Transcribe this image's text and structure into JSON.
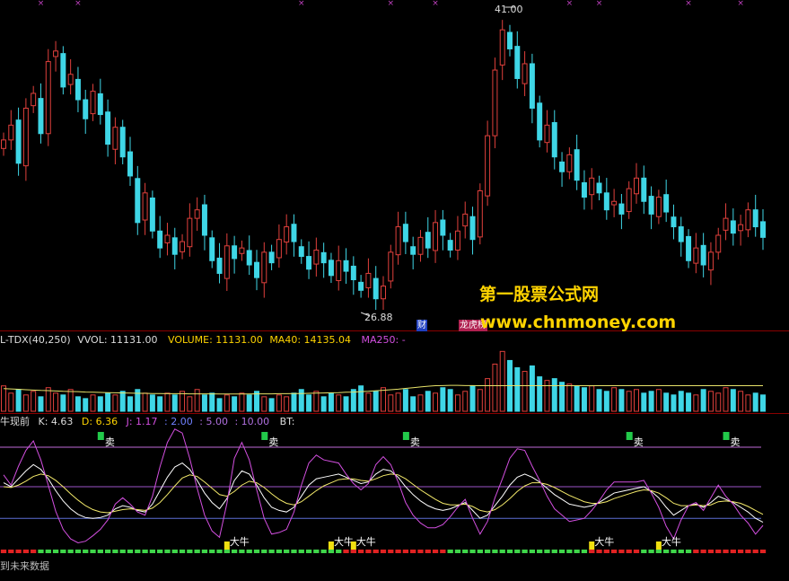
{
  "colors": {
    "up": "#e0403c",
    "down": "#3fd6e6",
    "bg": "#000000",
    "ma40": "#e8e36a",
    "k_line": "#ffffff",
    "d_line": "#f3e96a",
    "j_line": "#d34fe0",
    "top_band": "#c06ad8",
    "mid_band": "#9d55c8",
    "low_band": "#5d6fd6",
    "sell": "#22c94a",
    "buy": "#f0e010",
    "strip_green": "#3fd64a",
    "strip_red": "#e02222",
    "watermark": "#ffd400"
  },
  "price_panel": {
    "high_label": "41.00",
    "low_label": "26.88",
    "badge_1": "财",
    "badge_2": "龙虎榜"
  },
  "volume_panel": {
    "header_name": "L-TDX(40,250)",
    "vvol": "VVOL: 11131.00",
    "volume": "VOLUME: 11131.00",
    "ma40": "MA40: 14135.04",
    "ma250": "MA250: -"
  },
  "indicator_panel": {
    "header_name": "牛现前",
    "k": "K: 4.63",
    "d": "D: 6.36",
    "j": "J: 1.17",
    "l1": ": 2.00",
    "l2": ": 5.00",
    "l3": ": 10.00",
    "bt": "BT:",
    "sell_label": "卖",
    "buy_label": "大牛"
  },
  "footer_text": "到未来数据",
  "watermark": {
    "line1": "第一股票公式网",
    "line2": "www.chnmoney.com"
  },
  "chart_data": [
    {
      "type": "candlestick",
      "ylim": [
        26.88,
        41.0
      ],
      "annotations": [
        "41.00",
        "26.88"
      ],
      "values_close": [
        34.9,
        35.6,
        33.8,
        36.4,
        37.1,
        35.2,
        38.6,
        39.1,
        37.4,
        38.0,
        36.8,
        35.9,
        37.2,
        36.1,
        34.7,
        35.5,
        34.1,
        33.2,
        31.0,
        32.4,
        30.6,
        29.8,
        30.4,
        29.5,
        30.1,
        31.2,
        31.6,
        30.4,
        29.2,
        28.6,
        29.9,
        29.3,
        29.8,
        29.0,
        28.4,
        29.6,
        29.1,
        30.2,
        30.8,
        30.1,
        29.4,
        28.8,
        29.7,
        29.1,
        28.5,
        29.2,
        28.7,
        28.3,
        27.8,
        28.6,
        27.4,
        28.0,
        29.6,
        30.8,
        30.1,
        29.5,
        30.3,
        29.8,
        31.0,
        30.4,
        29.7,
        30.6,
        31.4,
        30.2,
        32.5,
        35.1,
        38.2,
        40.1,
        39.2,
        37.8,
        38.5,
        36.4,
        34.9,
        35.6,
        34.1,
        33.4,
        34.2,
        33.0,
        32.2,
        33.1,
        32.4,
        31.6,
        32.0,
        31.4,
        32.6,
        33.1,
        32.0,
        31.4,
        32.2,
        31.5,
        30.8,
        30.1,
        29.2,
        29.8,
        29.0,
        29.6,
        30.4,
        31.2,
        30.5,
        30.9,
        31.6,
        30.8,
        30.3
      ]
    },
    {
      "type": "bar",
      "title": "L-TDX(40,250)",
      "series": [
        {
          "name": "VOLUME",
          "values": [
            14,
            10,
            12,
            9,
            11,
            8,
            13,
            10,
            9,
            12,
            8,
            7,
            9,
            8,
            10,
            9,
            11,
            8,
            12,
            10,
            9,
            8,
            10,
            9,
            11,
            8,
            12,
            9,
            10,
            7,
            9,
            8,
            10,
            9,
            11,
            8,
            7,
            9,
            8,
            10,
            12,
            9,
            11,
            8,
            10,
            9,
            8,
            12,
            14,
            10,
            11,
            13,
            9,
            10,
            12,
            8,
            9,
            11,
            10,
            13,
            12,
            9,
            11,
            14,
            12,
            18,
            26,
            33,
            28,
            24,
            22,
            25,
            19,
            17,
            18,
            16,
            15,
            14,
            13,
            14,
            12,
            11,
            13,
            12,
            11,
            12,
            10,
            11,
            12,
            10,
            9,
            11,
            10,
            9,
            12,
            11,
            10,
            13,
            12,
            11,
            9,
            10,
            9
          ]
        },
        {
          "name": "MA40",
          "values": [
            12.5,
            12.3,
            12.1,
            11.9,
            11.7,
            11.5,
            11.4,
            11.2,
            11.0,
            10.9,
            10.8,
            10.6,
            10.5,
            10.4,
            10.3,
            10.2,
            10.1,
            10.0,
            9.9,
            9.9,
            9.8,
            9.8,
            9.7,
            9.7,
            9.7,
            9.6,
            9.6,
            9.6,
            9.6,
            9.5,
            9.5,
            9.5,
            9.5,
            9.5,
            9.6,
            9.6,
            9.6,
            9.7,
            9.7,
            9.8,
            9.8,
            9.9,
            10.0,
            10.1,
            10.2,
            10.3,
            10.5,
            10.6,
            10.8,
            11.0,
            11.3,
            11.6,
            11.9,
            12.2,
            12.6,
            13.0,
            13.4,
            13.8,
            14.1,
            14.2,
            14.3,
            14.3,
            14.2,
            14.2,
            14.1,
            14.1,
            14.1,
            14.1,
            14.1,
            14.1,
            14.1,
            14.1,
            14.1,
            14.1,
            14.1,
            14.1,
            14.1,
            14.1,
            14.1,
            14.1,
            14.1,
            14.1,
            14.1,
            14.1,
            14.1,
            14.1,
            14.1,
            14.1,
            14.1,
            14.1,
            14.1,
            14.1,
            14.1,
            14.1,
            14.1,
            14.1,
            14.1,
            14.1,
            14.1,
            14.1,
            14.1,
            14.1,
            14.1
          ]
        }
      ]
    },
    {
      "type": "line",
      "title": "牛现前",
      "series": [
        {
          "name": "K",
          "values": [
            55,
            50,
            60,
            70,
            78,
            72,
            60,
            45,
            32,
            22,
            15,
            11,
            10,
            11,
            14,
            22,
            26,
            24,
            20,
            18,
            28,
            45,
            62,
            75,
            80,
            72,
            58,
            42,
            30,
            22,
            35,
            58,
            70,
            66,
            52,
            36,
            24,
            20,
            18,
            24,
            38,
            52,
            60,
            62,
            64,
            66,
            62,
            58,
            54,
            56,
            66,
            72,
            70,
            62,
            50,
            40,
            32,
            26,
            22,
            20,
            22,
            26,
            30,
            20,
            10,
            14,
            26,
            38,
            52,
            62,
            66,
            62,
            56,
            48,
            40,
            34,
            28,
            26,
            24,
            26,
            30,
            36,
            42,
            44,
            46,
            48,
            50,
            44,
            36,
            24,
            14,
            20,
            26,
            28,
            24,
            30,
            38,
            34,
            30,
            24,
            18,
            10,
            5
          ]
        },
        {
          "name": "D",
          "values": [
            50,
            49,
            52,
            57,
            63,
            66,
            64,
            58,
            50,
            41,
            33,
            26,
            21,
            18,
            17,
            19,
            21,
            22,
            21,
            20,
            23,
            30,
            40,
            51,
            61,
            65,
            63,
            56,
            48,
            40,
            38,
            44,
            52,
            57,
            55,
            49,
            41,
            34,
            29,
            27,
            31,
            38,
            45,
            51,
            55,
            59,
            60,
            60,
            58,
            57,
            60,
            64,
            66,
            65,
            60,
            53,
            46,
            40,
            34,
            29,
            27,
            27,
            28,
            25,
            20,
            18,
            21,
            27,
            35,
            44,
            51,
            55,
            55,
            53,
            49,
            44,
            39,
            35,
            31,
            29,
            29,
            31,
            35,
            38,
            41,
            44,
            46,
            45,
            42,
            36,
            29,
            26,
            26,
            27,
            26,
            27,
            31,
            32,
            31,
            29,
            25,
            20,
            15
          ]
        },
        {
          "name": "J",
          "values": [
            65,
            52,
            76,
            96,
            108,
            84,
            52,
            19,
            -4,
            -16,
            -21,
            -19,
            -12,
            -4,
            8,
            28,
            36,
            28,
            18,
            14,
            38,
            75,
            106,
            123,
            118,
            86,
            48,
            14,
            -6,
            -14,
            29,
            86,
            106,
            84,
            46,
            10,
            -10,
            -8,
            -4,
            18,
            52,
            80,
            90,
            84,
            82,
            80,
            66,
            54,
            46,
            54,
            78,
            88,
            78,
            56,
            30,
            14,
            4,
            -2,
            -2,
            2,
            12,
            24,
            34,
            10,
            -10,
            6,
            36,
            60,
            86,
            98,
            96,
            76,
            58,
            38,
            22,
            14,
            6,
            8,
            10,
            20,
            32,
            46,
            56,
            56,
            56,
            56,
            58,
            42,
            24,
            0,
            -16,
            8,
            26,
            30,
            20,
            36,
            52,
            38,
            28,
            14,
            4,
            -10,
            1
          ]
        }
      ]
    }
  ]
}
